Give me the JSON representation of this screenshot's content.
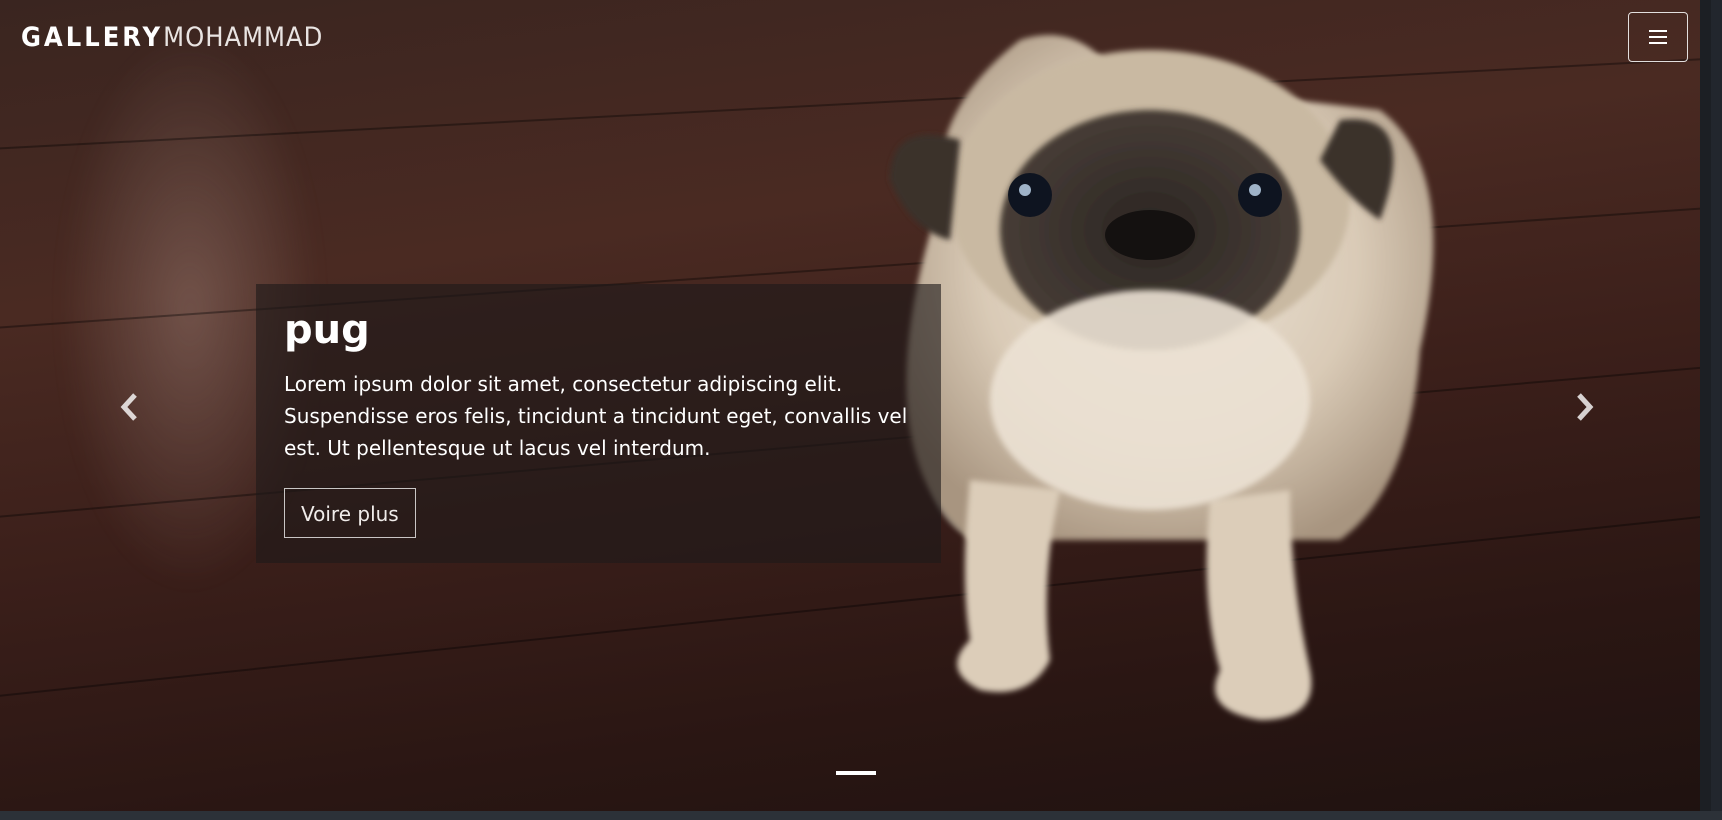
{
  "navbar": {
    "brand_bold": "GALLERY",
    "brand_light": "MOHAMMAD",
    "menu_icon": "hamburger-menu-icon"
  },
  "carousel": {
    "prev_icon": "chevron-left-icon",
    "next_icon": "chevron-right-icon",
    "slide": {
      "title": "pug",
      "text": "Lorem ipsum dolor sit amet, consectetur adipiscing elit. Suspendisse eros felis, tincidunt a tincidunt eget, convallis vel est. Ut pellentesque ut lacus vel interdum.",
      "button_label": "Voire plus"
    },
    "indicators": [
      {
        "active": true
      }
    ]
  },
  "colors": {
    "floor": "#3b1f1a",
    "caption_bg": "rgba(30,26,26,0.62)",
    "text": "#ffffff"
  }
}
